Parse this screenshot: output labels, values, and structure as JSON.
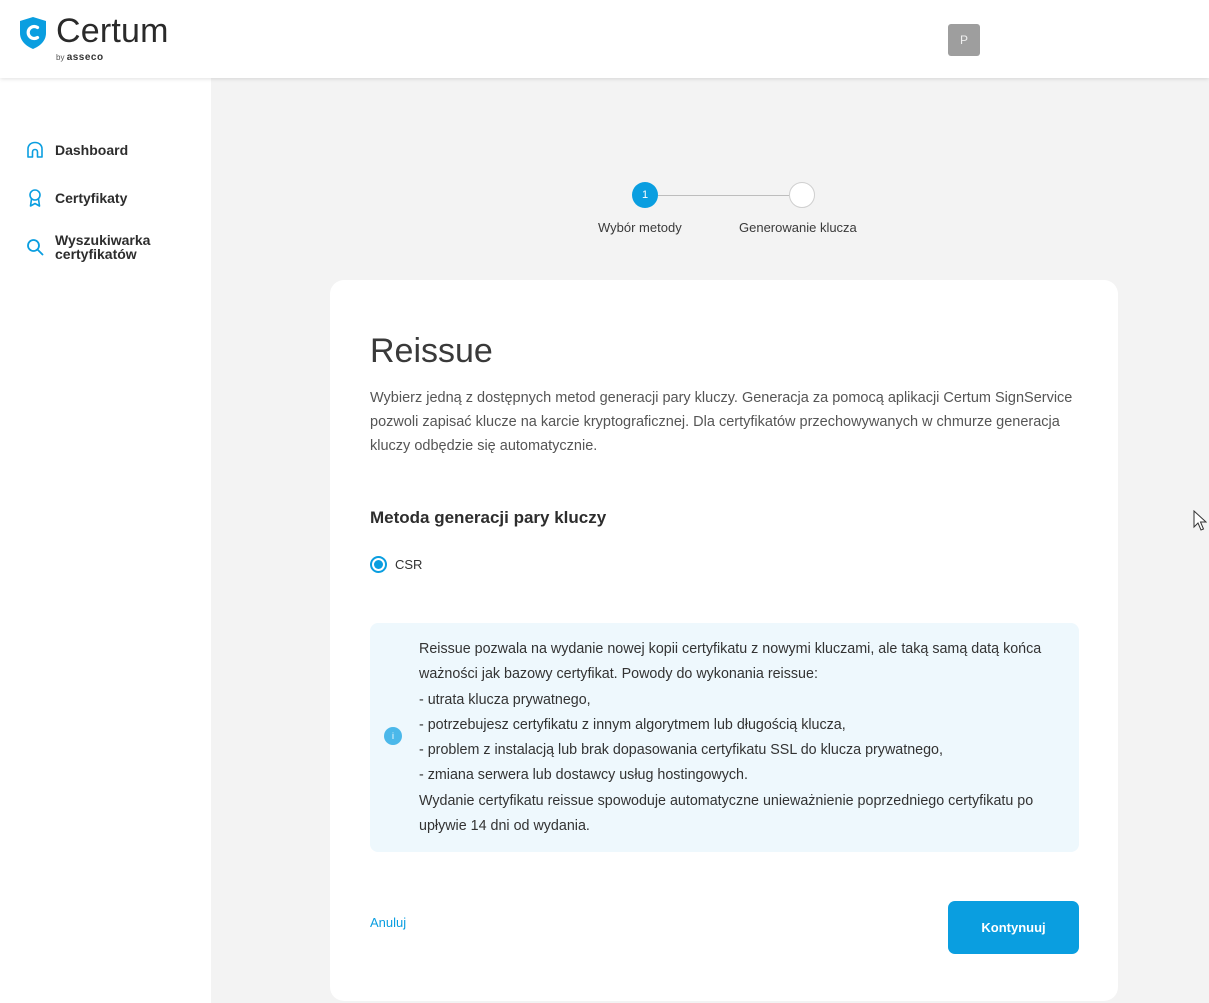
{
  "brand": {
    "name": "Certum",
    "by_prefix": "by",
    "by_company": "asseco",
    "color": "#0a9ee0"
  },
  "header": {
    "avatar_initial": "P"
  },
  "sidebar": {
    "items": [
      {
        "label": "Dashboard",
        "icon": "home-icon"
      },
      {
        "label": "Certyfikaty",
        "icon": "award-icon"
      },
      {
        "label": "Wyszukiwarka certyfikatów",
        "icon": "search-icon"
      }
    ]
  },
  "stepper": {
    "steps": [
      {
        "number": "1",
        "label": "Wybór metody",
        "active": true
      },
      {
        "number": "",
        "label": "Generowanie klucza",
        "active": false
      }
    ]
  },
  "card": {
    "title": "Reissue",
    "description": "Wybierz jedną z dostępnych metod generacji pary kluczy. Generacja za pomocą aplikacji Certum SignService pozwoli zapisać klucze na karcie kryptograficznej. Dla certyfikatów przechowywanych w chmurze generacja kluczy odbędzie się automatycznie.",
    "section_title": "Metoda generacji pary kluczy",
    "radio_option": "CSR",
    "info_icon": "i",
    "info_lines": [
      "Reissue pozwala na wydanie nowej kopii certyfikatu z nowymi kluczami, ale taką samą datą końca ważności jak bazowy certyfikat. Powody do wykonania reissue:",
      "- utrata klucza prywatnego,",
      "- potrzebujesz certyfikatu z innym algorytmem lub długością klucza,",
      "- problem z instalacją lub brak dopasowania certyfikatu SSL do klucza prywatnego,",
      "- zmiana serwera lub dostawcy usług hostingowych.",
      "Wydanie certyfikatu reissue spowoduje automatyczne unieważnienie poprzedniego certyfikatu po upływie 14 dni od wydania."
    ],
    "cancel_label": "Anuluj",
    "continue_label": "Kontynuuj"
  }
}
